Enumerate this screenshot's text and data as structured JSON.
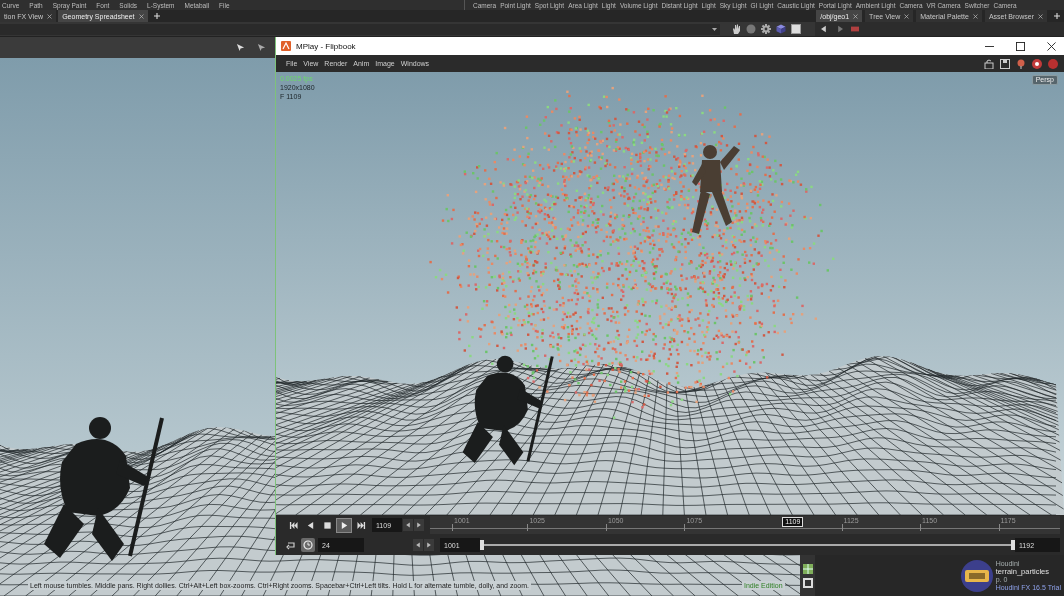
{
  "shelf": {
    "left_tools": [
      "Curve",
      "Path",
      "Spray Paint",
      "Font",
      "Solids",
      "L-System",
      "Metaball",
      "File"
    ],
    "right_tools": [
      "Camera",
      "Point Light",
      "Spot Light",
      "Area Light",
      "Light",
      "Volume Light",
      "Distant Light",
      "Light",
      "Sky Light",
      "GI Light",
      "Caustic Light",
      "Portal Light",
      "Ambient Light",
      "Camera",
      "VR Camera",
      "Switcher",
      "Camera"
    ]
  },
  "desktop_tabs": [
    {
      "label": "tion FX View",
      "selected": false
    },
    {
      "label": "Geometry Spreadsheet",
      "selected": true
    }
  ],
  "pane_tabs": [
    {
      "label": "/obj/geo1",
      "selected": true
    },
    {
      "label": "Tree View",
      "selected": false
    },
    {
      "label": "Material Palette",
      "selected": false
    },
    {
      "label": "Asset Browser",
      "selected": false
    }
  ],
  "viewport": {
    "status_text": "Left mouse tumbles. Middle pans. Right dollies. Ctrl+Alt+Left box-zooms. Ctrl+Right zooms. Spacebar+Ctrl+Left tilts. Hold L for alternate tumble, dolly, and zoom.",
    "edition_label": "Indie Edition"
  },
  "mplay": {
    "title": "MPlay - Flipbook",
    "menu": [
      "File",
      "View",
      "Render",
      "Anim",
      "Image",
      "Windows"
    ],
    "overlay_lines": [
      "0.0025 fps",
      "1920x1080",
      "F 1109"
    ],
    "view_button": "Persp",
    "timeline": {
      "playback_buttons": [
        {
          "kind": "first",
          "active": false
        },
        {
          "kind": "reverse",
          "active": false
        },
        {
          "kind": "stop",
          "active": false
        },
        {
          "kind": "play",
          "active": true
        },
        {
          "kind": "last",
          "active": false
        }
      ],
      "frame": "1109",
      "ticks": [
        "1001",
        "1025",
        "1050",
        "1075",
        "1125",
        "1150",
        "1175"
      ],
      "current_frame_marker": "1109",
      "realtime_toggle": {
        "on": true
      },
      "fps": "24",
      "range_start": "1001",
      "range_end": "1192"
    }
  },
  "network_pane": {
    "logo_lines": [
      "Houdini",
      "terrain_particles",
      "p. 0",
      "Houdini FX 16.5 Trial"
    ]
  }
}
